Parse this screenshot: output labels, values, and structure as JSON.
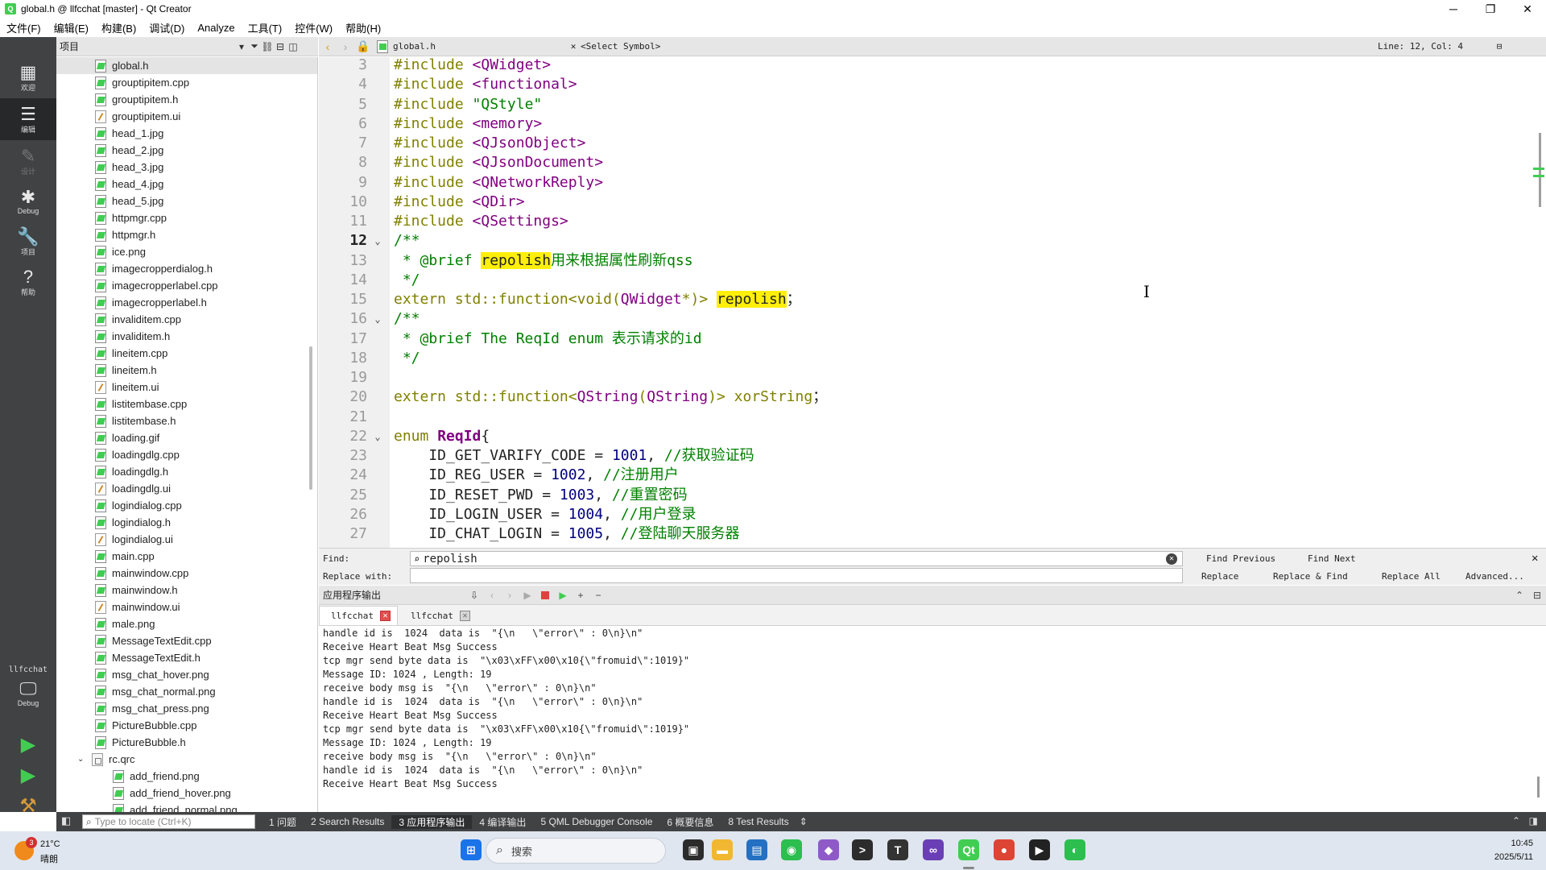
{
  "window": {
    "title": "global.h @ llfcchat [master] - Qt Creator",
    "app_icon_letter": "Q",
    "minimize": "─",
    "maximize": "❐",
    "close": "✕"
  },
  "menu": [
    "文件(F)",
    "编辑(E)",
    "构建(B)",
    "调试(D)",
    "Analyze",
    "工具(T)",
    "控件(W)",
    "帮助(H)"
  ],
  "modes": [
    {
      "label": "欢迎",
      "glyph": "▦"
    },
    {
      "label": "编辑",
      "glyph": "☰"
    },
    {
      "label": "设计",
      "glyph": "✎"
    },
    {
      "label": "Debug",
      "glyph": "✱"
    },
    {
      "label": "项目",
      "glyph": "🔧"
    },
    {
      "label": "帮助",
      "glyph": "?"
    }
  ],
  "kit": {
    "project": "llfcchat",
    "config": "Debug"
  },
  "project_panel": {
    "title": "项目",
    "files": [
      {
        "name": "global.h",
        "type": "src",
        "selected": true
      },
      {
        "name": "grouptipitem.cpp",
        "type": "src"
      },
      {
        "name": "grouptipitem.h",
        "type": "src"
      },
      {
        "name": "grouptipitem.ui",
        "type": "ui"
      },
      {
        "name": "head_1.jpg",
        "type": "src"
      },
      {
        "name": "head_2.jpg",
        "type": "src"
      },
      {
        "name": "head_3.jpg",
        "type": "src"
      },
      {
        "name": "head_4.jpg",
        "type": "src"
      },
      {
        "name": "head_5.jpg",
        "type": "src"
      },
      {
        "name": "httpmgr.cpp",
        "type": "src"
      },
      {
        "name": "httpmgr.h",
        "type": "src"
      },
      {
        "name": "ice.png",
        "type": "src"
      },
      {
        "name": "imagecropperdialog.h",
        "type": "src"
      },
      {
        "name": "imagecropperlabel.cpp",
        "type": "src"
      },
      {
        "name": "imagecropperlabel.h",
        "type": "src"
      },
      {
        "name": "invaliditem.cpp",
        "type": "src"
      },
      {
        "name": "invaliditem.h",
        "type": "src"
      },
      {
        "name": "lineitem.cpp",
        "type": "src"
      },
      {
        "name": "lineitem.h",
        "type": "src"
      },
      {
        "name": "lineitem.ui",
        "type": "ui"
      },
      {
        "name": "listitembase.cpp",
        "type": "src"
      },
      {
        "name": "listitembase.h",
        "type": "src"
      },
      {
        "name": "loading.gif",
        "type": "src"
      },
      {
        "name": "loadingdlg.cpp",
        "type": "src"
      },
      {
        "name": "loadingdlg.h",
        "type": "src"
      },
      {
        "name": "loadingdlg.ui",
        "type": "ui"
      },
      {
        "name": "logindialog.cpp",
        "type": "src"
      },
      {
        "name": "logindialog.h",
        "type": "src"
      },
      {
        "name": "logindialog.ui",
        "type": "ui"
      },
      {
        "name": "main.cpp",
        "type": "src"
      },
      {
        "name": "mainwindow.cpp",
        "type": "src"
      },
      {
        "name": "mainwindow.h",
        "type": "src"
      },
      {
        "name": "mainwindow.ui",
        "type": "ui"
      },
      {
        "name": "male.png",
        "type": "src"
      },
      {
        "name": "MessageTextEdit.cpp",
        "type": "src"
      },
      {
        "name": "MessageTextEdit.h",
        "type": "src"
      },
      {
        "name": "msg_chat_hover.png",
        "type": "src"
      },
      {
        "name": "msg_chat_normal.png",
        "type": "src"
      },
      {
        "name": "msg_chat_press.png",
        "type": "src"
      },
      {
        "name": "PictureBubble.cpp",
        "type": "src"
      },
      {
        "name": "PictureBubble.h",
        "type": "src"
      },
      {
        "name": "rc.qrc",
        "type": "qrc",
        "expanded": true
      },
      {
        "name": "add_friend.png",
        "type": "src",
        "child": true
      },
      {
        "name": "add_friend_hover.png",
        "type": "src",
        "child": true
      },
      {
        "name": "add_friend_normal.png",
        "type": "src",
        "child": true
      }
    ]
  },
  "editor_toolbar": {
    "file": "global.h",
    "symbol": "<Select Symbol>",
    "position": "Line: 12, Col: 4"
  },
  "code": [
    {
      "n": 3,
      "parts": [
        [
          "kw",
          "#include "
        ],
        [
          "inc",
          "<QWidget>"
        ]
      ]
    },
    {
      "n": 4,
      "parts": [
        [
          "kw",
          "#include "
        ],
        [
          "inc",
          "<functional>"
        ]
      ]
    },
    {
      "n": 5,
      "parts": [
        [
          "kw",
          "#include "
        ],
        [
          "str",
          "\"QStyle\""
        ]
      ]
    },
    {
      "n": 6,
      "parts": [
        [
          "kw",
          "#include "
        ],
        [
          "inc",
          "<memory>"
        ]
      ]
    },
    {
      "n": 7,
      "parts": [
        [
          "kw",
          "#include "
        ],
        [
          "inc",
          "<QJsonObject>"
        ]
      ]
    },
    {
      "n": 8,
      "parts": [
        [
          "kw",
          "#include "
        ],
        [
          "inc",
          "<QJsonDocument>"
        ]
      ]
    },
    {
      "n": 9,
      "parts": [
        [
          "kw",
          "#include "
        ],
        [
          "inc",
          "<QNetworkReply>"
        ]
      ]
    },
    {
      "n": 10,
      "parts": [
        [
          "kw",
          "#include "
        ],
        [
          "inc",
          "<QDir>"
        ]
      ]
    },
    {
      "n": 11,
      "parts": [
        [
          "kw",
          "#include "
        ],
        [
          "inc",
          "<QSettings>"
        ]
      ]
    },
    {
      "n": 12,
      "fold": true,
      "current": true,
      "parts": [
        [
          "cmt",
          "/**"
        ]
      ]
    },
    {
      "n": 13,
      "parts": [
        [
          "cmt",
          " * @brief "
        ],
        [
          "hl",
          "repolish"
        ],
        [
          "cmt",
          "用来根据属性刷新qss"
        ]
      ]
    },
    {
      "n": 14,
      "parts": [
        [
          "cmt",
          " */"
        ]
      ]
    },
    {
      "n": 15,
      "parts": [
        [
          "kw",
          "extern "
        ],
        [
          "kw",
          "std::function<"
        ],
        [
          "kw",
          "void"
        ],
        [
          "kw",
          "("
        ],
        [
          "ty",
          "QWidget"
        ],
        [
          "kw",
          "*)> "
        ],
        [
          "hl",
          "repolish"
        ],
        [
          "",
          "；"
        ]
      ]
    },
    {
      "n": 16,
      "fold": true,
      "parts": [
        [
          "cmt",
          "/**"
        ]
      ]
    },
    {
      "n": 17,
      "parts": [
        [
          "cmt",
          " * @brief The ReqId enum 表示请求的id"
        ]
      ]
    },
    {
      "n": 18,
      "parts": [
        [
          "cmt",
          " */"
        ]
      ]
    },
    {
      "n": 19,
      "parts": []
    },
    {
      "n": 20,
      "parts": [
        [
          "kw",
          "extern "
        ],
        [
          "kw",
          "std::function<"
        ],
        [
          "ty",
          "QString"
        ],
        [
          "kw",
          "("
        ],
        [
          "ty",
          "QString"
        ],
        [
          "kw",
          ")> xorString"
        ],
        [
          "",
          "；"
        ]
      ]
    },
    {
      "n": 21,
      "parts": []
    },
    {
      "n": 22,
      "fold": true,
      "parts": [
        [
          "kw",
          "enum "
        ],
        [
          "en",
          "ReqId"
        ],
        [
          "",
          "{"
        ]
      ]
    },
    {
      "n": 23,
      "parts": [
        [
          "",
          "    ID_GET_VARIFY_CODE = "
        ],
        [
          "num",
          "1001"
        ],
        [
          "",
          ", "
        ],
        [
          "cmt",
          "//获取验证码"
        ]
      ]
    },
    {
      "n": 24,
      "parts": [
        [
          "",
          "    ID_REG_USER = "
        ],
        [
          "num",
          "1002"
        ],
        [
          "",
          ", "
        ],
        [
          "cmt",
          "//注册用户"
        ]
      ]
    },
    {
      "n": 25,
      "parts": [
        [
          "",
          "    ID_RESET_PWD = "
        ],
        [
          "num",
          "1003"
        ],
        [
          "",
          ", "
        ],
        [
          "cmt",
          "//重置密码"
        ]
      ]
    },
    {
      "n": 26,
      "parts": [
        [
          "",
          "    ID_LOGIN_USER = "
        ],
        [
          "num",
          "1004"
        ],
        [
          "",
          ", "
        ],
        [
          "cmt",
          "//用户登录"
        ]
      ]
    },
    {
      "n": 27,
      "parts": [
        [
          "",
          "    ID_CHAT_LOGIN = "
        ],
        [
          "num",
          "1005"
        ],
        [
          "",
          ", "
        ],
        [
          "cmt",
          "//登陆聊天服务器"
        ]
      ]
    }
  ],
  "find": {
    "find_label": "Find:",
    "replace_label": "Replace with:",
    "find_value": "repolish",
    "replace_value": "",
    "find_previous": "Find Previous",
    "find_next": "Find Next",
    "replace": "Replace",
    "replace_find": "Replace & Find",
    "replace_all": "Replace All",
    "advanced": "Advanced..."
  },
  "output": {
    "title": "应用程序输出",
    "tabs": [
      {
        "label": "llfcchat",
        "active": true
      },
      {
        "label": "llfcchat",
        "active": false
      }
    ],
    "lines": [
      "handle id is  1024  data is  \"{\\n   \\\"error\\\" : 0\\n}\\n\"",
      "Receive Heart Beat Msg Success",
      "tcp mgr send byte data is  \"\\x03\\xFF\\x00\\x10{\\\"fromuid\\\":1019}\"",
      "Message ID: 1024 , Length: 19",
      "receive body msg is  \"{\\n   \\\"error\\\" : 0\\n}\\n\"",
      "handle id is  1024  data is  \"{\\n   \\\"error\\\" : 0\\n}\\n\"",
      "Receive Heart Beat Msg Success",
      "tcp mgr send byte data is  \"\\x03\\xFF\\x00\\x10{\\\"fromuid\\\":1019}\"",
      "Message ID: 1024 , Length: 19",
      "receive body msg is  \"{\\n   \\\"error\\\" : 0\\n}\\n\"",
      "handle id is  1024  data is  \"{\\n   \\\"error\\\" : 0\\n}\\n\"",
      "Receive Heart Beat Msg Success"
    ]
  },
  "statusbar": {
    "locator_placeholder": "Type to locate (Ctrl+K)",
    "panes": [
      {
        "label": "1 问题"
      },
      {
        "label": "2 Search Results"
      },
      {
        "label": "3 应用程序输出",
        "active": true
      },
      {
        "label": "4 编译输出"
      },
      {
        "label": "5 QML Debugger Console"
      },
      {
        "label": "6 概要信息"
      },
      {
        "label": "8 Test Results"
      }
    ]
  },
  "taskbar": {
    "weather_temp": "21°C",
    "weather_cond": "晴朗",
    "weather_badge": "3",
    "search_placeholder": "搜索",
    "time": "10:45",
    "date": "2025/5/11",
    "apps": [
      {
        "name": "windows-start-icon",
        "color": "#1a73e8",
        "glyph": "⊞"
      },
      {
        "name": "task-view-icon",
        "color": "#2b2b2b",
        "glyph": "▣"
      },
      {
        "name": "file-explorer-icon",
        "color": "#f2b731",
        "glyph": "▬"
      },
      {
        "name": "store-icon",
        "color": "#2470c2",
        "glyph": "▤"
      },
      {
        "name": "wechat-icon",
        "color": "#2cbe4e",
        "glyph": "◉"
      },
      {
        "name": "app-cat-icon",
        "color": "#8f5ac7",
        "glyph": "◆"
      },
      {
        "name": "terminal-icon",
        "color": "#2c2c2c",
        "glyph": ">"
      },
      {
        "name": "typora-icon",
        "color": "#333333",
        "glyph": "T"
      },
      {
        "name": "visual-studio-icon",
        "color": "#6a3fb5",
        "glyph": "∞"
      },
      {
        "name": "qt-creator-icon",
        "color": "#41cd52",
        "glyph": "Qt"
      },
      {
        "name": "chrome-icon",
        "color": "#dd4433",
        "glyph": "●"
      },
      {
        "name": "camera-icon",
        "color": "#222222",
        "glyph": "▶"
      },
      {
        "name": "wechat-work-icon",
        "color": "#2cbe4e",
        "glyph": "◐"
      }
    ]
  }
}
